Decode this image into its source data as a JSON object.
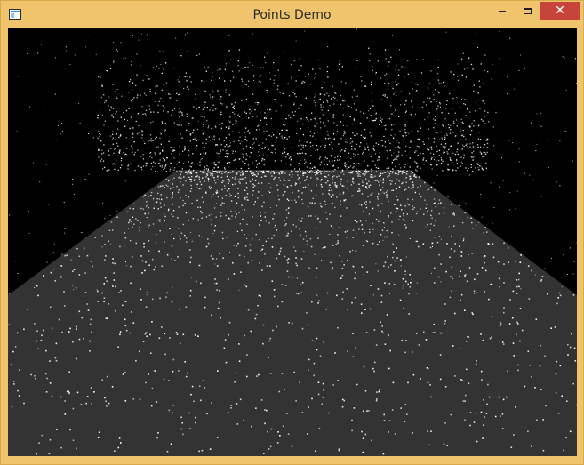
{
  "window": {
    "title": "Points Demo",
    "controls": {
      "minimize_icon": "minimize-icon",
      "maximize_icon": "maximize-icon",
      "close_icon": "close-icon",
      "close_glyph": "✕"
    },
    "frame_color": "#f0c46c",
    "close_color": "#c7443a"
  },
  "scene": {
    "sky_color": "#000000",
    "floor_color": "#333333",
    "point_color": "#ffffff"
  }
}
